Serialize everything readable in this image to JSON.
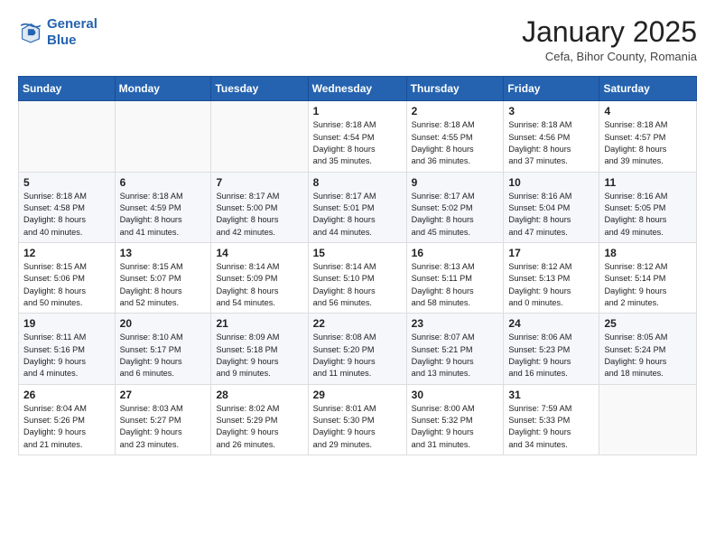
{
  "header": {
    "logo_line1": "General",
    "logo_line2": "Blue",
    "month": "January 2025",
    "location": "Cefa, Bihor County, Romania"
  },
  "weekdays": [
    "Sunday",
    "Monday",
    "Tuesday",
    "Wednesday",
    "Thursday",
    "Friday",
    "Saturday"
  ],
  "weeks": [
    [
      {
        "day": "",
        "info": ""
      },
      {
        "day": "",
        "info": ""
      },
      {
        "day": "",
        "info": ""
      },
      {
        "day": "1",
        "info": "Sunrise: 8:18 AM\nSunset: 4:54 PM\nDaylight: 8 hours\nand 35 minutes."
      },
      {
        "day": "2",
        "info": "Sunrise: 8:18 AM\nSunset: 4:55 PM\nDaylight: 8 hours\nand 36 minutes."
      },
      {
        "day": "3",
        "info": "Sunrise: 8:18 AM\nSunset: 4:56 PM\nDaylight: 8 hours\nand 37 minutes."
      },
      {
        "day": "4",
        "info": "Sunrise: 8:18 AM\nSunset: 4:57 PM\nDaylight: 8 hours\nand 39 minutes."
      }
    ],
    [
      {
        "day": "5",
        "info": "Sunrise: 8:18 AM\nSunset: 4:58 PM\nDaylight: 8 hours\nand 40 minutes."
      },
      {
        "day": "6",
        "info": "Sunrise: 8:18 AM\nSunset: 4:59 PM\nDaylight: 8 hours\nand 41 minutes."
      },
      {
        "day": "7",
        "info": "Sunrise: 8:17 AM\nSunset: 5:00 PM\nDaylight: 8 hours\nand 42 minutes."
      },
      {
        "day": "8",
        "info": "Sunrise: 8:17 AM\nSunset: 5:01 PM\nDaylight: 8 hours\nand 44 minutes."
      },
      {
        "day": "9",
        "info": "Sunrise: 8:17 AM\nSunset: 5:02 PM\nDaylight: 8 hours\nand 45 minutes."
      },
      {
        "day": "10",
        "info": "Sunrise: 8:16 AM\nSunset: 5:04 PM\nDaylight: 8 hours\nand 47 minutes."
      },
      {
        "day": "11",
        "info": "Sunrise: 8:16 AM\nSunset: 5:05 PM\nDaylight: 8 hours\nand 49 minutes."
      }
    ],
    [
      {
        "day": "12",
        "info": "Sunrise: 8:15 AM\nSunset: 5:06 PM\nDaylight: 8 hours\nand 50 minutes."
      },
      {
        "day": "13",
        "info": "Sunrise: 8:15 AM\nSunset: 5:07 PM\nDaylight: 8 hours\nand 52 minutes."
      },
      {
        "day": "14",
        "info": "Sunrise: 8:14 AM\nSunset: 5:09 PM\nDaylight: 8 hours\nand 54 minutes."
      },
      {
        "day": "15",
        "info": "Sunrise: 8:14 AM\nSunset: 5:10 PM\nDaylight: 8 hours\nand 56 minutes."
      },
      {
        "day": "16",
        "info": "Sunrise: 8:13 AM\nSunset: 5:11 PM\nDaylight: 8 hours\nand 58 minutes."
      },
      {
        "day": "17",
        "info": "Sunrise: 8:12 AM\nSunset: 5:13 PM\nDaylight: 9 hours\nand 0 minutes."
      },
      {
        "day": "18",
        "info": "Sunrise: 8:12 AM\nSunset: 5:14 PM\nDaylight: 9 hours\nand 2 minutes."
      }
    ],
    [
      {
        "day": "19",
        "info": "Sunrise: 8:11 AM\nSunset: 5:16 PM\nDaylight: 9 hours\nand 4 minutes."
      },
      {
        "day": "20",
        "info": "Sunrise: 8:10 AM\nSunset: 5:17 PM\nDaylight: 9 hours\nand 6 minutes."
      },
      {
        "day": "21",
        "info": "Sunrise: 8:09 AM\nSunset: 5:18 PM\nDaylight: 9 hours\nand 9 minutes."
      },
      {
        "day": "22",
        "info": "Sunrise: 8:08 AM\nSunset: 5:20 PM\nDaylight: 9 hours\nand 11 minutes."
      },
      {
        "day": "23",
        "info": "Sunrise: 8:07 AM\nSunset: 5:21 PM\nDaylight: 9 hours\nand 13 minutes."
      },
      {
        "day": "24",
        "info": "Sunrise: 8:06 AM\nSunset: 5:23 PM\nDaylight: 9 hours\nand 16 minutes."
      },
      {
        "day": "25",
        "info": "Sunrise: 8:05 AM\nSunset: 5:24 PM\nDaylight: 9 hours\nand 18 minutes."
      }
    ],
    [
      {
        "day": "26",
        "info": "Sunrise: 8:04 AM\nSunset: 5:26 PM\nDaylight: 9 hours\nand 21 minutes."
      },
      {
        "day": "27",
        "info": "Sunrise: 8:03 AM\nSunset: 5:27 PM\nDaylight: 9 hours\nand 23 minutes."
      },
      {
        "day": "28",
        "info": "Sunrise: 8:02 AM\nSunset: 5:29 PM\nDaylight: 9 hours\nand 26 minutes."
      },
      {
        "day": "29",
        "info": "Sunrise: 8:01 AM\nSunset: 5:30 PM\nDaylight: 9 hours\nand 29 minutes."
      },
      {
        "day": "30",
        "info": "Sunrise: 8:00 AM\nSunset: 5:32 PM\nDaylight: 9 hours\nand 31 minutes."
      },
      {
        "day": "31",
        "info": "Sunrise: 7:59 AM\nSunset: 5:33 PM\nDaylight: 9 hours\nand 34 minutes."
      },
      {
        "day": "",
        "info": ""
      }
    ]
  ]
}
